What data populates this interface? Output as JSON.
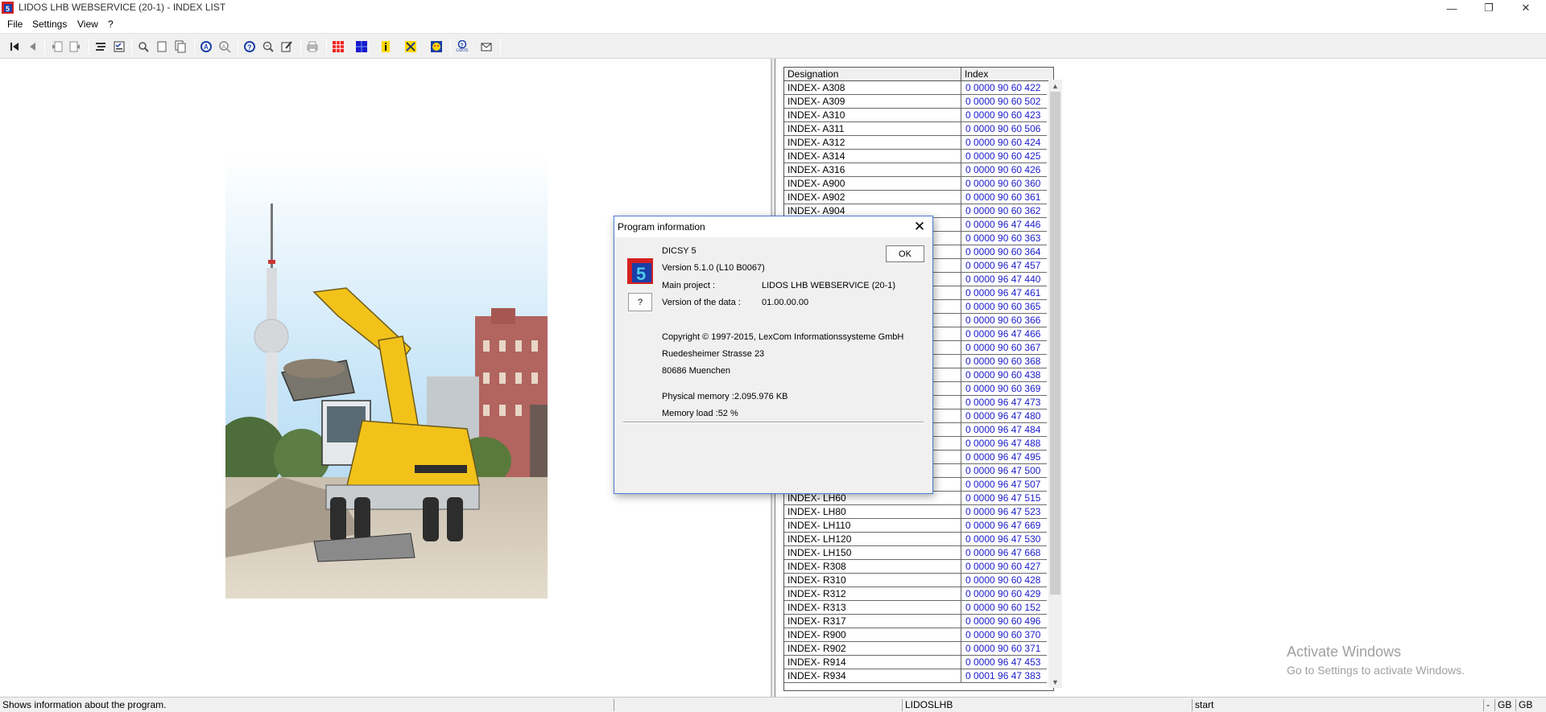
{
  "window": {
    "title": "LIDOS LHB WEBSERVICE (20-1) - INDEX LIST",
    "minimize": "—",
    "maximize": "❐",
    "close": "✕"
  },
  "menu": [
    "File",
    "Settings",
    "View",
    "?"
  ],
  "toolbar_icons": [
    "first-icon",
    "back-icon",
    "page-back-icon",
    "page-forward-icon",
    "list-icon",
    "checklist-icon",
    "zoom-icon",
    "page-icon",
    "copy-page-icon",
    "search-a-icon",
    "search-b-icon",
    "question-icon",
    "zoom-out-icon",
    "edit-icon",
    "print-icon",
    "grid-icon",
    "blue-grid-icon",
    "info-icon",
    "tools-icon",
    "mask-icon",
    "lidos-help-icon",
    "mail-icon"
  ],
  "lidos_label": "LIDOS",
  "table": {
    "headers": [
      "Designation",
      "Index"
    ],
    "rows": [
      [
        "INDEX- A308",
        "0 0000 90 60 422"
      ],
      [
        "INDEX- A309",
        "0 0000 90 60 502"
      ],
      [
        "INDEX- A310",
        "0 0000 90 60 423"
      ],
      [
        "INDEX- A311",
        "0 0000 90 60 506"
      ],
      [
        "INDEX- A312",
        "0 0000 90 60 424"
      ],
      [
        "INDEX- A314",
        "0 0000 90 60 425"
      ],
      [
        "INDEX- A316",
        "0 0000 90 60 426"
      ],
      [
        "INDEX- A900",
        "0 0000 90 60 360"
      ],
      [
        "INDEX- A902",
        "0 0000 90 60 361"
      ],
      [
        "INDEX- A904",
        "0 0000 90 60 362"
      ],
      [
        "",
        "0 0000 96 47 446"
      ],
      [
        "",
        "0 0000 90 60 363"
      ],
      [
        "",
        "0 0000 90 60 364"
      ],
      [
        "",
        "0 0000 96 47 457"
      ],
      [
        "",
        "0 0000 96 47 440"
      ],
      [
        "",
        "0 0000 96 47 461"
      ],
      [
        "",
        "0 0000 90 60 365"
      ],
      [
        "",
        "0 0000 90 60 366"
      ],
      [
        "",
        "0 0000 96 47 466"
      ],
      [
        "",
        "0 0000 90 60 367"
      ],
      [
        "",
        "0 0000 90 60 368"
      ],
      [
        "",
        "0 0000 90 60 438"
      ],
      [
        "",
        "0 0000 90 60 369"
      ],
      [
        "",
        "0 0000 96 47 473"
      ],
      [
        "",
        "0 0000 96 47 480"
      ],
      [
        "",
        "0 0000 96 47 484"
      ],
      [
        "",
        "0 0000 96 47 488"
      ],
      [
        "",
        "0 0000 96 47 495"
      ],
      [
        "",
        "0 0000 96 47 500"
      ],
      [
        "",
        "0 0000 96 47 507"
      ],
      [
        "INDEX- LH60",
        "0 0000 96 47 515"
      ],
      [
        "INDEX- LH80",
        "0 0000 96 47 523"
      ],
      [
        "INDEX- LH110",
        "0 0000 96 47 669"
      ],
      [
        "INDEX- LH120",
        "0 0000 96 47 530"
      ],
      [
        "INDEX- LH150",
        "0 0000 96 47 668"
      ],
      [
        "INDEX- R308",
        "0 0000 90 60 427"
      ],
      [
        "INDEX- R310",
        "0 0000 90 60 428"
      ],
      [
        "INDEX- R312",
        "0 0000 90 60 429"
      ],
      [
        "INDEX- R313",
        "0 0000 90 60 152"
      ],
      [
        "INDEX- R317",
        "0 0000 90 60 496"
      ],
      [
        "INDEX- R900",
        "0 0000 90 60 370"
      ],
      [
        "INDEX- R902",
        "0 0000 90 60 371"
      ],
      [
        "INDEX- R914",
        "0 0000 96 47 453"
      ],
      [
        "INDEX- R934",
        "0 0001 96 47 383"
      ]
    ]
  },
  "dialog": {
    "title": "Program information",
    "close": "✕",
    "product": "DICSY 5",
    "version": "Version 5.1.0   (L10 B0067)",
    "main_project_label": "Main project :",
    "main_project_value": "LIDOS LHB WEBSERVICE (20-1)",
    "data_version_label": "Version of the data :",
    "data_version_value": "01.00.00.00",
    "copyright": "Copyright © 1997-2015, LexCom Informationssysteme GmbH",
    "street": "Ruedesheimer Strasse 23",
    "city": "80686 Muenchen",
    "physical_memory": "Physical memory :2.095.976 KB",
    "memory_load": "Memory load :52 %",
    "ok_label": "OK",
    "help_label": "?"
  },
  "watermark": {
    "line1": "Activate Windows",
    "line2": "Go to Settings to activate Windows."
  },
  "statusbar": {
    "message": "Shows information about the program.",
    "panel2": "LIDOSLHB",
    "panel3": "start",
    "panel4": "-",
    "panel5": "GB",
    "panel6": "GB"
  },
  "colors": {
    "index_link": "#1a1acc",
    "dialog_border": "#4a7bd0",
    "excavator_yellow": "#f2c21a"
  }
}
